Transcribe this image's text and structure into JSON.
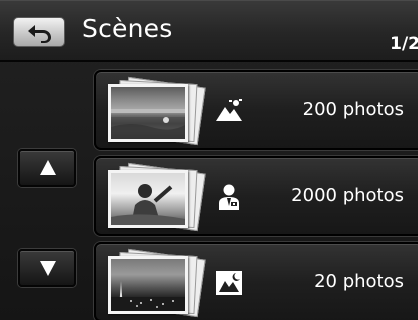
{
  "header": {
    "title": "Scènes",
    "page_indicator": "1/2",
    "back_icon": "back-arrow-icon"
  },
  "scroll": {
    "up_icon": "triangle-up-icon",
    "down_icon": "triangle-down-icon"
  },
  "scenes": [
    {
      "mode_icon": "landscape-mode-icon",
      "count_label": "200 photos"
    },
    {
      "mode_icon": "portrait-mode-icon",
      "count_label": "2000 photos"
    },
    {
      "mode_icon": "night-scene-icon",
      "count_label": "20 photos"
    }
  ],
  "colors": {
    "background": "#1b1b1b",
    "header": "#2a2a2a",
    "text": "#ffffff",
    "back_button": "#d0d0d0"
  }
}
